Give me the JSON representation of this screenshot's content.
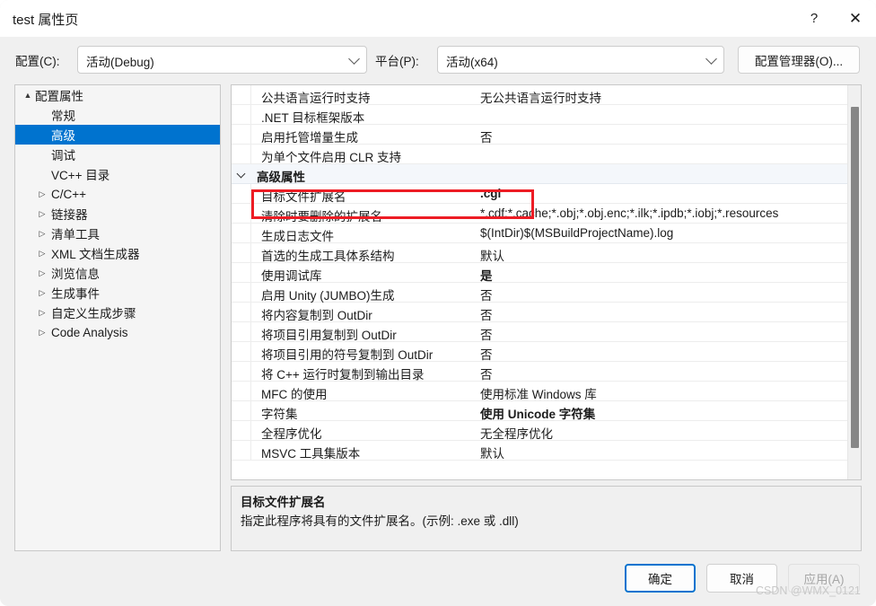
{
  "window": {
    "title": "test 属性页",
    "help_icon": "question-mark-icon",
    "close_icon": "close-icon"
  },
  "config_strip": {
    "config_label": "配置(C):",
    "config_value": "活动(Debug)",
    "platform_label": "平台(P):",
    "platform_value": "活动(x64)",
    "config_manager_button": "配置管理器(O)..."
  },
  "tree": {
    "items": [
      {
        "label": "配置属性",
        "indent": 0,
        "arrow": "▲",
        "selected": false
      },
      {
        "label": "常规",
        "indent": 1,
        "arrow": "",
        "selected": false
      },
      {
        "label": "高级",
        "indent": 1,
        "arrow": "",
        "selected": true
      },
      {
        "label": "调试",
        "indent": 1,
        "arrow": "",
        "selected": false
      },
      {
        "label": "VC++ 目录",
        "indent": 1,
        "arrow": "",
        "selected": false
      },
      {
        "label": "C/C++",
        "indent": 1,
        "arrow": "▷",
        "selected": false
      },
      {
        "label": "链接器",
        "indent": 1,
        "arrow": "▷",
        "selected": false
      },
      {
        "label": "清单工具",
        "indent": 1,
        "arrow": "▷",
        "selected": false
      },
      {
        "label": "XML 文档生成器",
        "indent": 1,
        "arrow": "▷",
        "selected": false
      },
      {
        "label": "浏览信息",
        "indent": 1,
        "arrow": "▷",
        "selected": false
      },
      {
        "label": "生成事件",
        "indent": 1,
        "arrow": "▷",
        "selected": false
      },
      {
        "label": "自定义生成步骤",
        "indent": 1,
        "arrow": "▷",
        "selected": false
      },
      {
        "label": "Code Analysis",
        "indent": 1,
        "arrow": "▷",
        "selected": false
      }
    ]
  },
  "grid": {
    "rows": [
      {
        "name": "公共语言运行时支持",
        "value": "无公共语言运行时支持",
        "group": false,
        "bold_value": false
      },
      {
        "name": ".NET 目标框架版本",
        "value": "",
        "group": false,
        "bold_value": false
      },
      {
        "name": "启用托管增量生成",
        "value": "否",
        "group": false,
        "bold_value": false
      },
      {
        "name": "为单个文件启用 CLR 支持",
        "value": "",
        "group": false,
        "bold_value": false
      },
      {
        "name": "高级属性",
        "value": "",
        "group": true,
        "bold_value": false
      },
      {
        "name": "目标文件扩展名",
        "value": ".cgi",
        "group": false,
        "bold_value": true
      },
      {
        "name": "清除时要删除的扩展名",
        "value": "*.cdf;*.cache;*.obj;*.obj.enc;*.ilk;*.ipdb;*.iobj;*.resources",
        "group": false,
        "bold_value": false
      },
      {
        "name": "生成日志文件",
        "value": "$(IntDir)$(MSBuildProjectName).log",
        "group": false,
        "bold_value": false
      },
      {
        "name": "首选的生成工具体系结构",
        "value": "默认",
        "group": false,
        "bold_value": false
      },
      {
        "name": "使用调试库",
        "value": "是",
        "group": false,
        "bold_value": true
      },
      {
        "name": "启用 Unity (JUMBO)生成",
        "value": "否",
        "group": false,
        "bold_value": false
      },
      {
        "name": "将内容复制到 OutDir",
        "value": "否",
        "group": false,
        "bold_value": false
      },
      {
        "name": "将项目引用复制到 OutDir",
        "value": "否",
        "group": false,
        "bold_value": false
      },
      {
        "name": "将项目引用的符号复制到 OutDir",
        "value": "否",
        "group": false,
        "bold_value": false
      },
      {
        "name": "将 C++ 运行时复制到输出目录",
        "value": "否",
        "group": false,
        "bold_value": false
      },
      {
        "name": "MFC 的使用",
        "value": "使用标准 Windows 库",
        "group": false,
        "bold_value": false
      },
      {
        "name": "字符集",
        "value": "使用 Unicode 字符集",
        "group": false,
        "bold_value": true
      },
      {
        "name": "全程序优化",
        "value": "无全程序优化",
        "group": false,
        "bold_value": false
      },
      {
        "name": "MSVC 工具集版本",
        "value": "默认",
        "group": false,
        "bold_value": false
      }
    ]
  },
  "description": {
    "title": "目标文件扩展名",
    "body": "指定此程序将具有的文件扩展名。(示例: .exe 或 .dll)"
  },
  "footer": {
    "ok": "确定",
    "cancel": "取消",
    "apply": "应用(A)"
  },
  "watermark": "CSDN @WMX_0121"
}
